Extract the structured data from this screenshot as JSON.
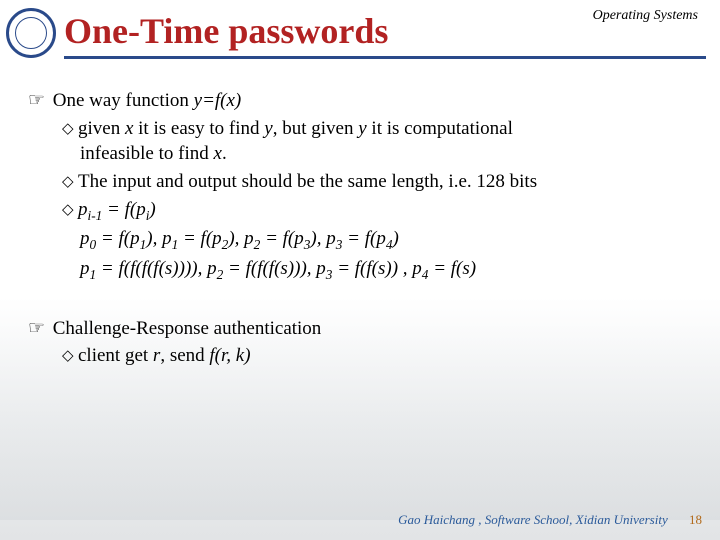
{
  "header": {
    "title": "One-Time passwords",
    "running_head": "Operating Systems"
  },
  "section1": {
    "heading_pre": "One way function ",
    "heading_fn": "y=f(x)",
    "b1a": "given ",
    "b1b": " it is easy to find ",
    "b1c": ", but given ",
    "b1d": " it is computational",
    "b1e": "infeasible to find ",
    "b1f": ".",
    "b2": "The input and output should be the same length, i.e. 128 bits",
    "b3_line1": "p_(i-1) = f(p_i)",
    "b3_line2": "p_0 = f(p_1), p_1 = f(p_2), p_2 = f(p_3), p_3 = f(p_4)",
    "b3_line3": "p_1 = f(f(f(f(s)))), p_2 = f(f(f(s))), p_3 = f(f(s)) , p_4 = f(s)",
    "vars": {
      "x": "x",
      "y": "y"
    }
  },
  "section2": {
    "heading": "Challenge-Response authentication",
    "b1_pre": "client  get ",
    "b1_r": "r",
    "b1_mid": ", send ",
    "b1_fn": "f(r, k)"
  },
  "footer": {
    "credit": "Gao Haichang , Software School, Xidian University",
    "page": "18"
  }
}
